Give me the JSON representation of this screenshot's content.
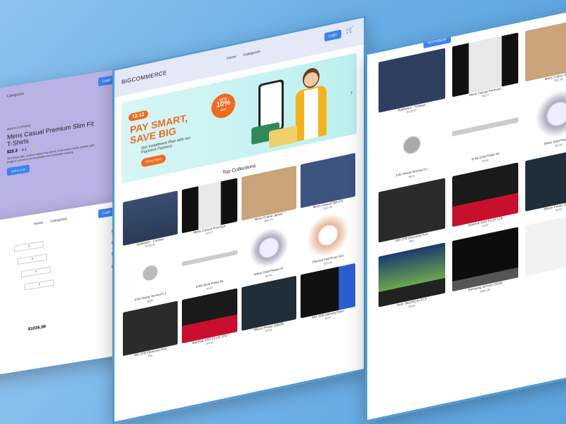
{
  "left_panel": {
    "nav": {
      "home": "Home",
      "categories": "Categories",
      "login": "Login"
    },
    "product": {
      "breadcrumb": "MEN'S CLOTHING",
      "title": "Mens Casual Premium Slim Fit T-Shirts",
      "price": "$22.3",
      "rating": "4.1",
      "description": "Slim-fitting style, contrast raglan long sleeve, three-button henley placket, light weight & soft fabric for breathable and comfortable wearing.",
      "add_label": "Add to Cart"
    },
    "cart": {
      "nav": {
        "home": "Home",
        "categories": "Categories",
        "login": "Login"
      },
      "qty": [
        "1",
        "1",
        "1",
        "1"
      ],
      "subtotal": "$1036.98"
    }
  },
  "center_panel": {
    "logo": "BIGCOMMERCE",
    "nav": {
      "home": "Home",
      "categories": "Categories",
      "login": "Login"
    },
    "banner": {
      "date": "12.12",
      "headline": "PAY SMART, SAVE BIG",
      "sub": "Get Installment Plan with our Payment Partners",
      "cta": "Shop Now",
      "badge_top": "UPTO",
      "badge_pct": "10%",
      "badge_off": "OFF"
    },
    "section_title": "Top Collections",
    "products": [
      {
        "name": "Fjallraven - Foldsac",
        "price": "$109.95"
      },
      {
        "name": "Mens Casual Premium",
        "price": "$22.3"
      },
      {
        "name": "Mens Cotton Jacket",
        "price": "$55.99"
      },
      {
        "name": "Mens Casual Slim Fit",
        "price": "$15.99"
      },
      {
        "name": "John Hardy Women's L",
        "price": "$695"
      },
      {
        "name": "Solid Gold Petite Mi",
        "price": "$168"
      },
      {
        "name": "White Gold Plated Pr",
        "price": "$9.99"
      },
      {
        "name": "Pierced Owl Rose Gol",
        "price": "$10.99"
      },
      {
        "name": "WD 2TB Elements Port",
        "price": "$64"
      },
      {
        "name": "SanDisk SSD PLUS 1TB",
        "price": "$109"
      },
      {
        "name": "Silicon Power 256GB",
        "price": "$109"
      },
      {
        "name": "WD 4TB Gaming Drive",
        "price": "$114"
      }
    ]
  },
  "right_panel": {
    "tab": "All Products",
    "products": [
      {
        "name": "Fjallraven - Foldsac",
        "price": "$109.95"
      },
      {
        "name": "Mens Casual Premium",
        "price": "$22.3"
      },
      {
        "name": "Mens Cotton Jacket",
        "price": "$55.99"
      },
      {
        "name": "John Hardy Women's L",
        "price": "$695"
      },
      {
        "name": "Solid Gold Petite Mi",
        "price": "$168"
      },
      {
        "name": "White Gold Plated Pr",
        "price": "$9.99"
      },
      {
        "name": "WD 2TB Elements Port",
        "price": "$64"
      },
      {
        "name": "SanDisk SSD PLUS 1TB",
        "price": "$109"
      },
      {
        "name": "Silicon Power 256GB",
        "price": "$109"
      },
      {
        "name": "Acer SB220Q bi 21.5",
        "price": "$599"
      },
      {
        "name": "Samsung 49-Inch CHG9",
        "price": "$999.99"
      }
    ]
  },
  "colors": {
    "accent": "#3b82f6",
    "lavender": "#b9b2e4",
    "banner": "#bdeff0",
    "orange": "#f26a1f"
  }
}
